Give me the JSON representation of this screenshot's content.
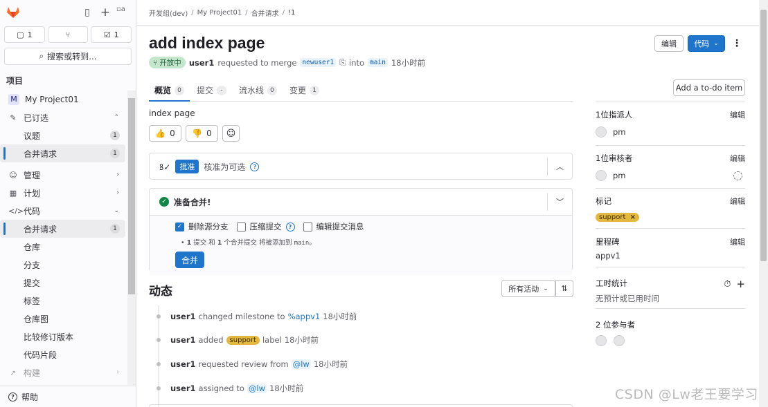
{
  "sidebar": {
    "avatar_alt": "a",
    "counters": [
      {
        "icon": "issue-icon",
        "glyph": "▢",
        "value": "1"
      },
      {
        "icon": "merge-request-icon",
        "glyph": "⑂",
        "value": ""
      },
      {
        "icon": "todo-icon",
        "glyph": "☑",
        "value": "1"
      }
    ],
    "search_label": "搜索或转到...",
    "section_title": "项目",
    "project_initial": "M",
    "project_name": "My Project01",
    "pinned": "已订选",
    "pinned_items": [
      {
        "label": "议题",
        "badge": "1"
      },
      {
        "label": "合并请求",
        "badge": "1"
      }
    ],
    "manage": "管理",
    "plan": "计划",
    "code": "代码",
    "code_items": [
      {
        "label": "合并请求",
        "badge": "1"
      },
      {
        "label": "仓库"
      },
      {
        "label": "分支"
      },
      {
        "label": "提交"
      },
      {
        "label": "标签"
      },
      {
        "label": "仓库图"
      },
      {
        "label": "比较修订版本"
      },
      {
        "label": "代码片段"
      }
    ],
    "build": "构建",
    "help": "帮助"
  },
  "breadcrumb": [
    "开发组(dev)",
    "My Project01",
    "合并请求",
    "!1"
  ],
  "mr": {
    "title": "add index page",
    "edit_label": "编辑",
    "code_label": "代码",
    "status": "开放中",
    "author": "user1",
    "requested_text": "requested to merge",
    "source_branch": "newuser1",
    "into_text": "into",
    "target_branch": "main",
    "time": "18小时前",
    "todo_label": "Add a to-do item",
    "tabs": [
      {
        "label": "概览",
        "count": "0"
      },
      {
        "label": "提交",
        "count": "-"
      },
      {
        "label": "流水线",
        "count": "0"
      },
      {
        "label": "变更",
        "count": "1"
      }
    ],
    "description": "index page",
    "thumbs_up": "0",
    "thumbs_down": "0"
  },
  "approval": {
    "tag": "批准",
    "text": "核准为可选"
  },
  "merge": {
    "title": "准备合并!",
    "opt_delete": "删除源分支",
    "opt_squash": "压缩提交",
    "opt_edit": "编辑提交消息",
    "note_n1": "1",
    "note_t1": "提交 和",
    "note_n2": "1",
    "note_t2": "个合并提交 将被添加到",
    "note_branch": "main",
    "note_end": "。",
    "button": "合并"
  },
  "activity": {
    "title": "动态",
    "filter": "所有活动",
    "items": [
      {
        "user": "user1",
        "pre": "changed milestone to",
        "ref": "%appv1",
        "post": "",
        "time": "18小时前"
      },
      {
        "user": "user1",
        "pre": "added",
        "ref": "support",
        "post": "label",
        "time": "18小时前"
      },
      {
        "user": "user1",
        "pre": "requested review from",
        "ref": "@lw",
        "post": "",
        "time": "18小时前"
      },
      {
        "user": "user1",
        "pre": "assigned to",
        "ref": "@lw",
        "post": "",
        "time": "18小时前"
      }
    ]
  },
  "right": {
    "assignee_title": "1位指派人",
    "assignee_name": "pm",
    "reviewer_title": "1位审核者",
    "reviewer_name": "pm",
    "labels_title": "标记",
    "label": "support",
    "milestone_title": "里程碑",
    "milestone": "appv1",
    "time_title": "工时统计",
    "time_text": "无预计或已用时间",
    "participants_title": "2 位参与者",
    "edit": "编辑"
  },
  "colors": {
    "accent": "#1f75cb",
    "success": "#108548",
    "label_support": "#e3b83e"
  },
  "watermark": "CSDN @Lw老王要学习"
}
